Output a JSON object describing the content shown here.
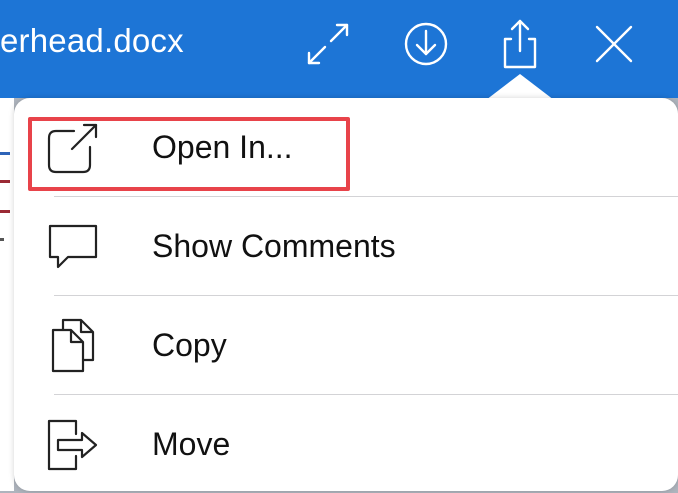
{
  "topbar": {
    "title": "erhead.docx",
    "icons": [
      "expand-icon",
      "download-icon",
      "share-icon",
      "close-icon"
    ],
    "background": "#1d75d6"
  },
  "menu": {
    "items": [
      {
        "label": "Open In...",
        "icon": "open-in-icon"
      },
      {
        "label": "Show Comments",
        "icon": "comment-icon"
      },
      {
        "label": "Copy",
        "icon": "copy-icon"
      },
      {
        "label": "Move",
        "icon": "move-icon"
      }
    ],
    "highlighted_item": "Open In...",
    "highlight_color": "#e8434a"
  }
}
